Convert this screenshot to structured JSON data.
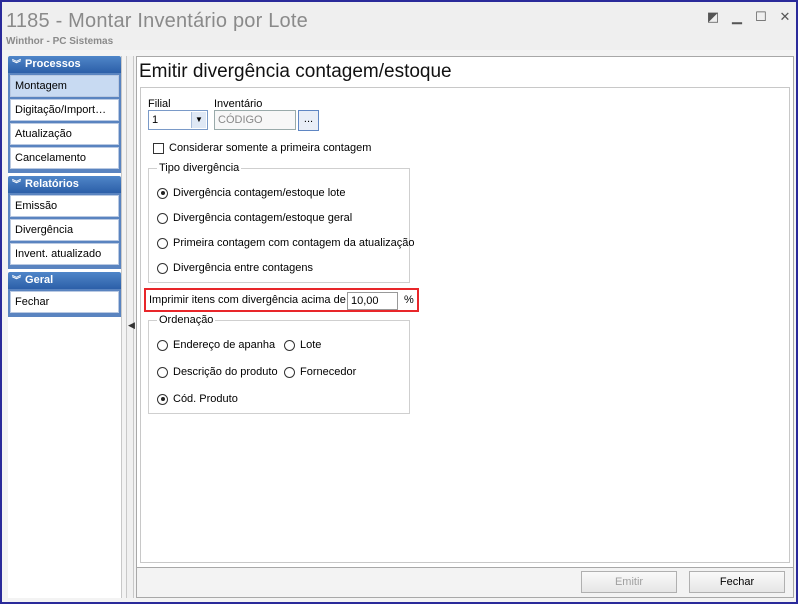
{
  "window": {
    "title": "1185 - Montar Inventário por Lote",
    "subtitle": "Winthor - PC Sistemas"
  },
  "sidebar": {
    "groups": [
      {
        "title": "Processos",
        "items": [
          "Montagem",
          "Digitação/Import…",
          "Atualização",
          "Cancelamento"
        ]
      },
      {
        "title": "Relatórios",
        "items": [
          "Emissão",
          "Divergência",
          "Invent. atualizado"
        ]
      },
      {
        "title": "Geral",
        "items": [
          "Fechar"
        ]
      }
    ],
    "active_item": "Montagem"
  },
  "main": {
    "title": "Emitir divergência contagem/estoque",
    "filial_label": "Filial",
    "filial_value": "1",
    "inventario_label": "Inventário",
    "inventario_placeholder": "CÓDIGO",
    "lookup_button": "...",
    "checkbox_label": "Considerar somente a primeira contagem",
    "checkbox_checked": false,
    "tipo": {
      "legend": "Tipo divergência",
      "options": [
        "Divergência contagem/estoque lote",
        "Divergência contagem/estoque geral",
        "Primeira contagem com contagem da atualização",
        "Divergência entre contagens"
      ],
      "selected": 0
    },
    "imprimir": {
      "label": "Imprimir itens com divergência acima  de",
      "value": "10,00",
      "unit": "%"
    },
    "ordenacao": {
      "legend": "Ordenação",
      "options": [
        "Endereço de apanha",
        "Lote",
        "Descrição do produto",
        "Fornecedor",
        "Cód. Produto"
      ],
      "selected": 4
    }
  },
  "footer": {
    "emitir_label": "Emitir",
    "emitir_enabled": false,
    "fechar_label": "Fechar"
  }
}
